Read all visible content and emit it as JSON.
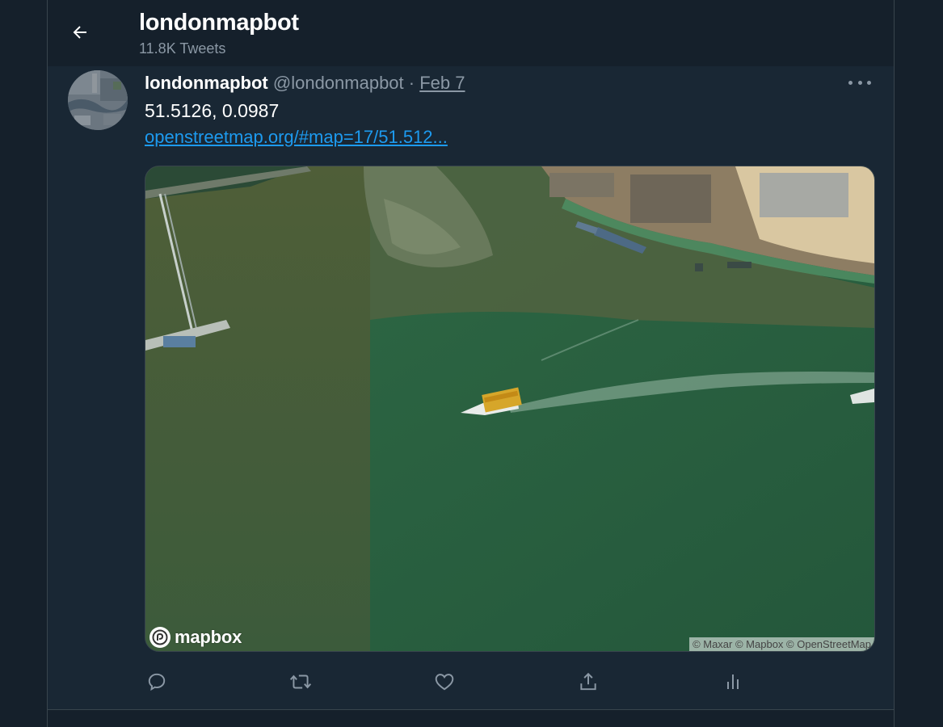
{
  "header": {
    "title": "londonmapbot",
    "tweet_count": "11.8K Tweets",
    "back_icon": "arrow-left-icon"
  },
  "tweet": {
    "author_name": "londonmapbot",
    "author_handle": "@londonmapbot",
    "separator": "·",
    "date": "Feb 7",
    "text": "51.5126, 0.0987",
    "link": "openstreetmap.org/#map=17/51.512...",
    "media": {
      "logo_text": "mapbox",
      "attribution": "© Maxar © Mapbox © OpenStreetMap"
    },
    "actions": [
      {
        "name": "reply-icon"
      },
      {
        "name": "retweet-icon"
      },
      {
        "name": "like-icon"
      },
      {
        "name": "share-icon"
      },
      {
        "name": "analytics-icon"
      }
    ]
  },
  "colors": {
    "background": "#15202b",
    "tweet_background": "#192734",
    "link": "#1d9bf0",
    "secondary_text": "#8b98a5",
    "border": "#38444d"
  }
}
